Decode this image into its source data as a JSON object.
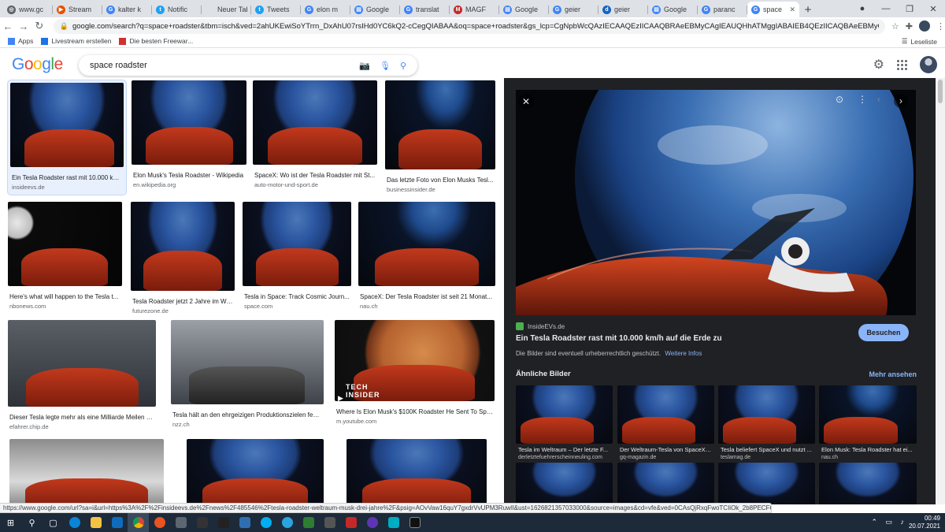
{
  "browser": {
    "tabs": [
      {
        "label": "www.gc",
        "color": "#5f6368",
        "icon": "globe-icon",
        "ch": "◎"
      },
      {
        "label": "Stream",
        "color": "#e65100",
        "icon": "stream-icon",
        "ch": "▶"
      },
      {
        "label": "kalter k",
        "color": "#4285f4",
        "icon": "google-icon",
        "ch": "G"
      },
      {
        "label": "Notific",
        "color": "#1da1f2",
        "icon": "twitter-icon",
        "ch": "t"
      },
      {
        "label": "Neuer Tab",
        "color": "#dee1e6",
        "icon": "blank-icon",
        "ch": ""
      },
      {
        "label": "Tweets",
        "color": "#1da1f2",
        "icon": "twitter-icon",
        "ch": "t"
      },
      {
        "label": "elon m",
        "color": "#4285f4",
        "icon": "google-icon",
        "ch": "G"
      },
      {
        "label": "Google",
        "color": "#4285f4",
        "icon": "google-docs-icon",
        "ch": "▤"
      },
      {
        "label": "translat",
        "color": "#4285f4",
        "icon": "google-icon",
        "ch": "G"
      },
      {
        "label": "MAGF",
        "color": "#c62828",
        "icon": "magf-icon",
        "ch": "M"
      },
      {
        "label": "Google",
        "color": "#4285f4",
        "icon": "google-docs-icon",
        "ch": "▤"
      },
      {
        "label": "geier",
        "color": "#4285f4",
        "icon": "google-icon",
        "ch": "G"
      },
      {
        "label": "geier",
        "color": "#1565c0",
        "icon": "site-icon",
        "ch": "d"
      },
      {
        "label": "Google",
        "color": "#4285f4",
        "icon": "google-docs-icon",
        "ch": "▤"
      },
      {
        "label": "paranc",
        "color": "#4285f4",
        "icon": "google-icon",
        "ch": "G"
      },
      {
        "label": "space",
        "color": "#4285f4",
        "icon": "google-icon",
        "ch": "G",
        "active": true
      }
    ],
    "url": "google.com/search?q=space+roadster&tbm=isch&ved=2ahUKEwiSoYTrrn_DxAhU07rsIHd0YC6kQ2-cCegQIABAA&oq=space+roadster&gs_lcp=CgNpbWcQAzIECAAQEzIICAAQBRAeEBMyCAgIEAUQHhATMggIABAIEB4QEzIICAQBAeEBMyCAgIEAgQHhATMggI",
    "bookmarks": [
      {
        "label": "Apps",
        "icon": "apps-grid-icon"
      },
      {
        "label": "Livestream erstellen",
        "icon": "livestream-icon"
      },
      {
        "label": "Die besten Freewar...",
        "icon": "freeware-icon"
      }
    ],
    "reading_list": "Leseliste"
  },
  "google": {
    "logo": "Google",
    "query": "space roadster"
  },
  "results": [
    {
      "title": "Ein Tesla Roadster rast mit 10.000 km/...",
      "source": "insideevs.de",
      "selected": true
    },
    {
      "title": "Elon Musk's Tesla Roadster - Wikipedia",
      "source": "en.wikipedia.org"
    },
    {
      "title": "SpaceX: Wo ist der Tesla Roadster mit St...",
      "source": "auto-motor-und-sport.de"
    },
    {
      "title": "Das letzte Foto von Elon Musks Tesl...",
      "source": "businessinsider.de"
    },
    {
      "title": "Here's what will happen to the Tesla t...",
      "source": "nbonews.com"
    },
    {
      "title": "Tesla Roadster jetzt 2 Jahre im Wel...",
      "source": "futurezone.de"
    },
    {
      "title": "Tesla in Space: Track Cosmic Journ...",
      "source": "space.com"
    },
    {
      "title": "SpaceX: Der Tesla Roadster ist seit 21 Monat...",
      "source": "nau.ch"
    },
    {
      "title": "Dieser Tesla legte mehr als eine Milliarde Meilen zur...",
      "source": "efahrer.chip.de"
    },
    {
      "title": "Tesla hält an den ehrgeizigen Produktionszielen fest | ...",
      "source": "nzz.ch"
    },
    {
      "title": "Where Is Elon Musk's $100K Roadster He Sent To Spac...",
      "source": "m.youtube.com",
      "overlay": "TECH\nINSIDER"
    }
  ],
  "panel": {
    "source": "InsideEVs.de",
    "title": "Ein Tesla Roadster rast mit 10.000 km/h auf die Erde zu",
    "note": "Die Bilder sind eventuell urheberrechtlich geschützt.",
    "note_link": "Weitere Infos",
    "visit_label": "Besuchen",
    "similar_heading": "Ähnliche Bilder",
    "more_label": "Mehr ansehen",
    "similar": [
      {
        "title": "Tesla im Weltraum – Der letzte F...",
        "source": "derletztefuehrerscheinneuling.com"
      },
      {
        "title": "Der Weltraum-Tesla von SpaceX ...",
        "source": "gq-magazin.de"
      },
      {
        "title": "Tesla beliefert SpaceX und nutzt ...",
        "source": "teslamag.de"
      },
      {
        "title": "Elon Musk: Tesla Roadster hat ei...",
        "source": "nau.ch"
      }
    ]
  },
  "status_url": "https://www.google.com/url?sa=i&url=https%3A%2F%2Finsideevs.de%2Fnews%2F485546%2Ftesla-roadster-weltraum-musk-drei-jahre%2F&psig=AOvVaw16quY7gxdrVvUPM3RuwIl&ust=1626821357033000&source=images&cd=vfe&ved=0CAsQjRxqFwoTCIiOk_2b8PECFQAAAAAdAAAAABAD",
  "taskbar": {
    "time": "00:49",
    "date": "20.07.2021"
  },
  "colors": {
    "panel_bg": "#202124",
    "accent_blue": "#8ab4f8"
  }
}
